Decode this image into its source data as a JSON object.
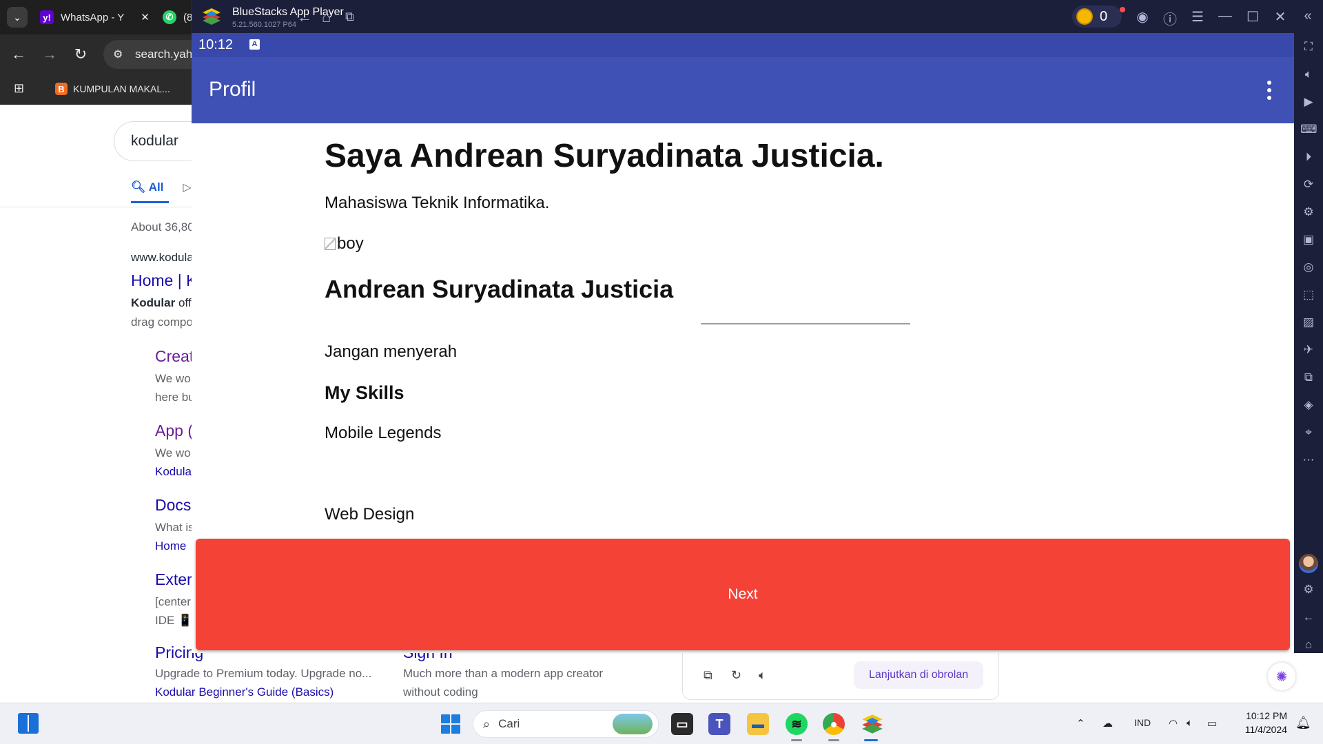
{
  "chrome": {
    "tabs": [
      {
        "label": "WhatsApp - Y",
        "favicon": "y!"
      },
      {
        "label": "(8",
        "favicon": "whatsapp"
      }
    ],
    "close_glyph": "✕",
    "address": "search.yah",
    "bookmarks": [
      {
        "label": "KUMPULAN MAKAL..."
      }
    ]
  },
  "yahoo": {
    "query": "kodular",
    "tab_all": "All",
    "result_count": "About 36,80",
    "url": "www.kodula",
    "title": "Home | K",
    "snippet_bold": "Kodular",
    "snippet_rest": " off",
    "snippet_line2": "drag compo",
    "sublinks": [
      {
        "title": "Creat",
        "line1": "We wo",
        "line2": "here bu"
      },
      {
        "title": "App (",
        "line1": "We wo",
        "line2": "Kodula"
      },
      {
        "title": "Docs",
        "line1": "What is",
        "line2": "Home"
      },
      {
        "title": "Exter",
        "line1": "[center",
        "line2": "IDE 📱"
      }
    ],
    "pricing": {
      "title": "Pricing",
      "line1": "Upgrade to Premium today. Upgrade no...",
      "line2": "Kodular Beginner's Guide (Basics)"
    },
    "signin": {
      "title": "Sign In",
      "line1": "Much more than a modern app creator",
      "line2": "without coding"
    },
    "chat_continue": "Lanjutkan di obrolan"
  },
  "bluestacks": {
    "title": "BlueStacks App Player",
    "version": "5.21.560.1027  P64",
    "coins": "0"
  },
  "android": {
    "status_time": "10:12",
    "status_icon": "A",
    "appbar_title": "Profil",
    "content": {
      "heading": "Saya Andrean Suryadinata Justicia.",
      "subtitle": "Mahasiswa Teknik Informatika.",
      "image_alt": "boy",
      "name": "Andrean Suryadinata Justicia",
      "motto": "Jangan menyerah",
      "skills_heading": "My Skills",
      "skills": [
        "Mobile Legends",
        "Web Design"
      ]
    },
    "next_button": "Next"
  },
  "taskbar": {
    "search_placeholder": "Cari",
    "language": "IND",
    "time": "10:12 PM",
    "date": "11/4/2024"
  },
  "colors": {
    "appbar": "#3f51b5",
    "statusbar": "#3949ab",
    "next_button": "#f44336",
    "bluestacks_chrome": "#1c1f3a"
  }
}
